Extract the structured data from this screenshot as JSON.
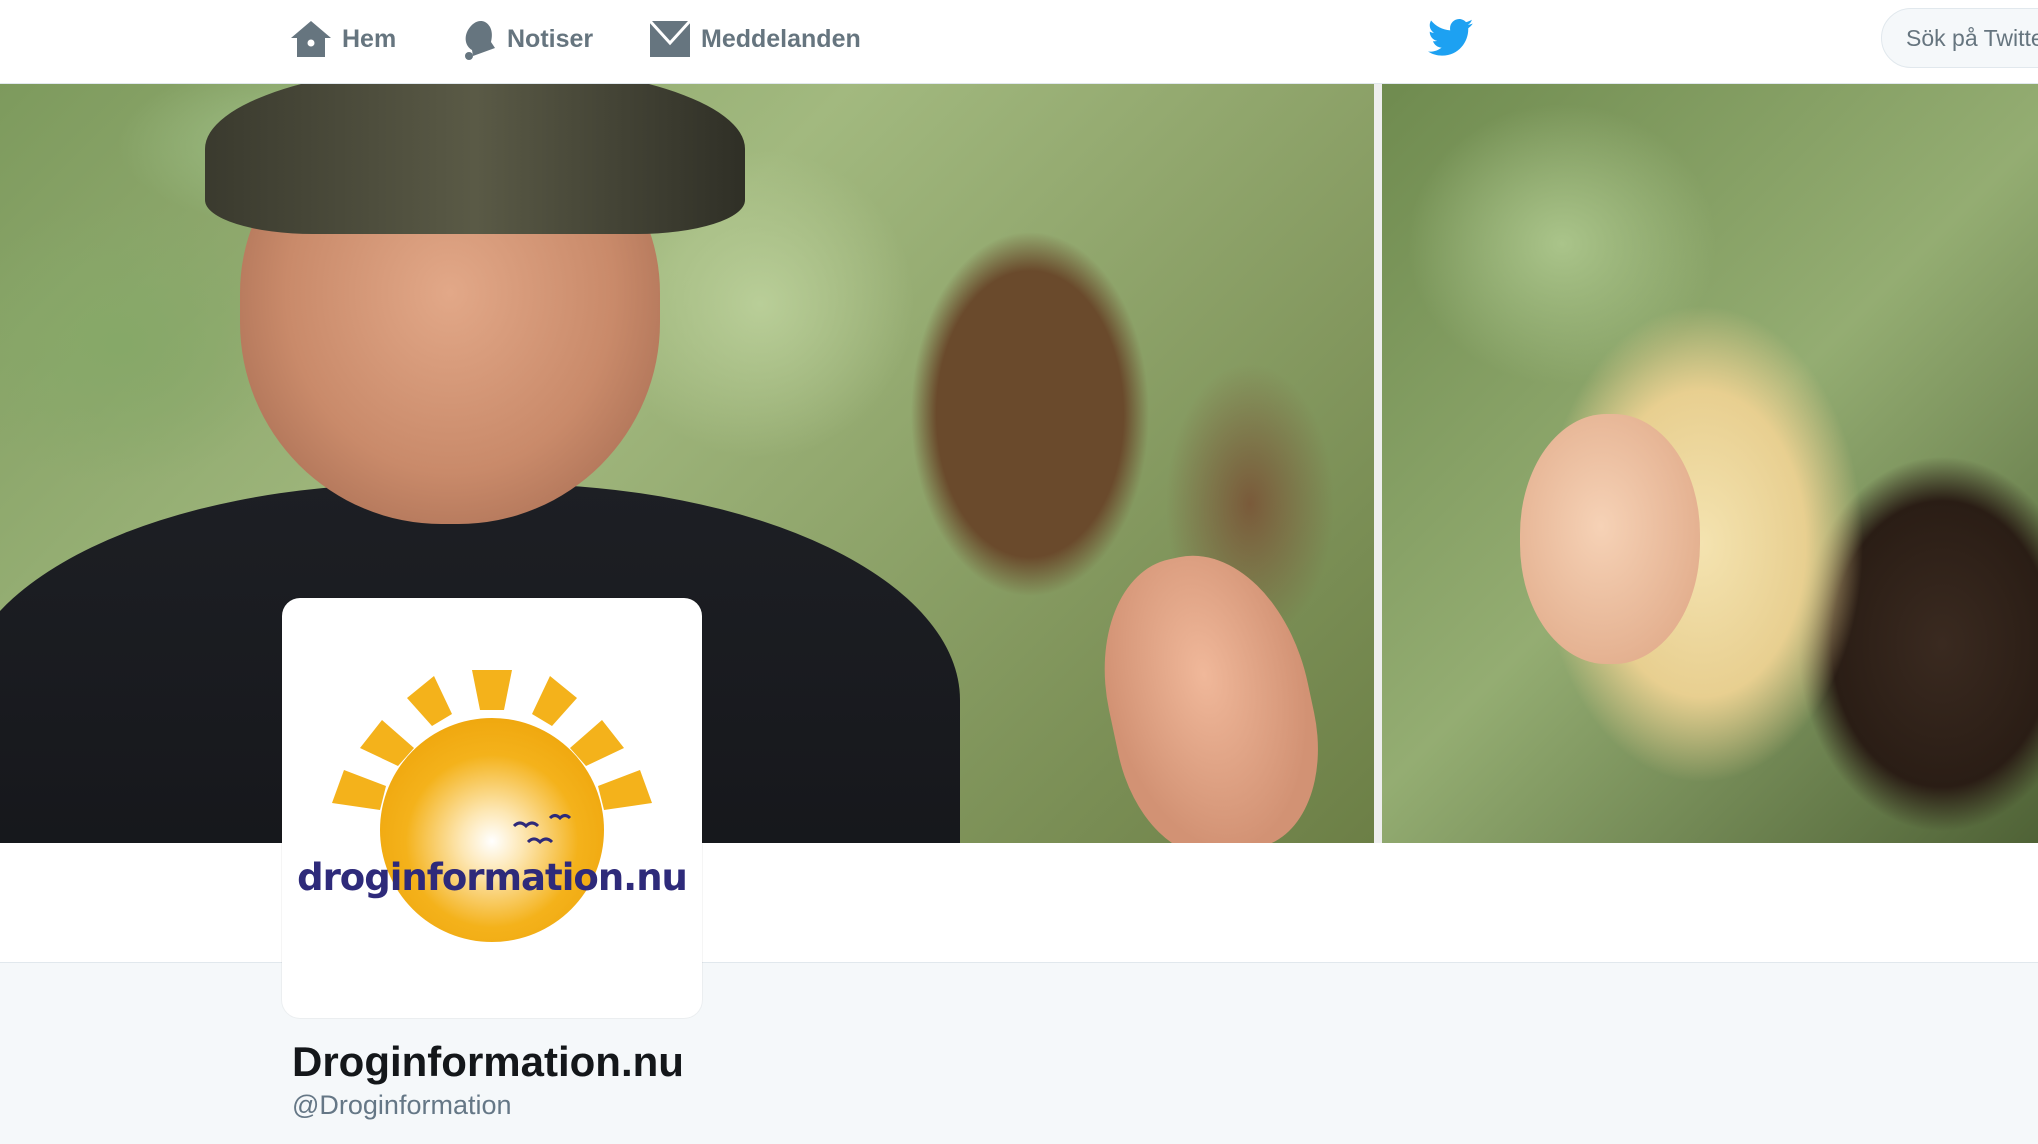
{
  "nav": {
    "home_label": "Hem",
    "home_icon": "home-icon",
    "notifications_label": "Notiser",
    "notifications_icon": "bell-icon",
    "messages_label": "Meddelanden",
    "messages_icon": "envelope-icon"
  },
  "brand": {
    "logo_icon": "twitter-bird-icon",
    "logo_color": "#1da1f2"
  },
  "search": {
    "placeholder": "Sök på Twitter"
  },
  "profile": {
    "avatar_wordmark": "droginformation.nu",
    "name": "Droginformation.nu",
    "handle": "@Droginformation"
  },
  "colors": {
    "nav_text": "#66757f",
    "sun": "#f4b21b",
    "wordmark": "#2e2a7a",
    "page_background": "#f5f8fa"
  }
}
